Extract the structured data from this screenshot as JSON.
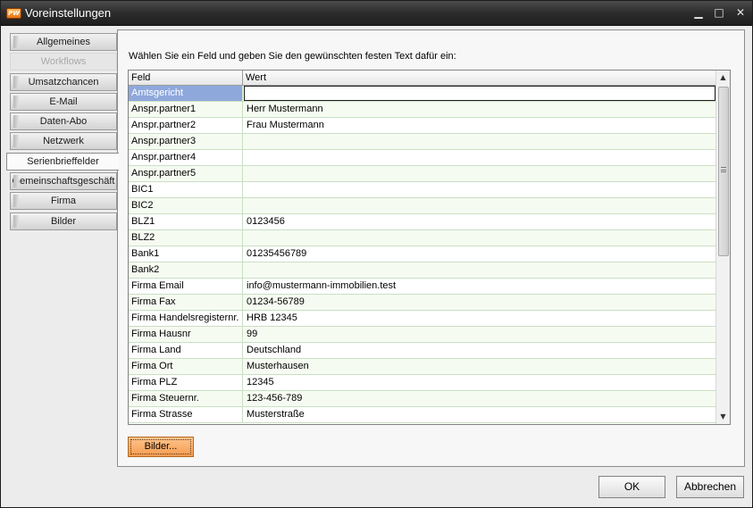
{
  "window": {
    "title": "Voreinstellungen",
    "app_icon_text": "PW",
    "minimize_glyph": "▁",
    "maximize_glyph": "□",
    "close_glyph": "✕"
  },
  "nav": {
    "items": [
      {
        "label": "Allgemeines",
        "state": "normal"
      },
      {
        "label": "Workflows",
        "state": "disabled"
      },
      {
        "label": "Umsatzchancen",
        "state": "normal"
      },
      {
        "label": "E-Mail",
        "state": "normal"
      },
      {
        "label": "Daten-Abo",
        "state": "normal"
      },
      {
        "label": "Netzwerk",
        "state": "normal"
      },
      {
        "label": "Serienbrieffelder",
        "state": "active"
      },
      {
        "label": "Gemeinschaftsgeschäft",
        "state": "normal"
      },
      {
        "label": "Firma",
        "state": "normal"
      },
      {
        "label": "Bilder",
        "state": "normal"
      }
    ]
  },
  "main": {
    "instruction": "Wählen Sie ein Feld und geben Sie den gewünschten festen Text dafür ein:",
    "grid": {
      "columns": [
        "Feld",
        "Wert"
      ],
      "rows": [
        {
          "feld": "Amtsgericht",
          "wert": "",
          "selected": true
        },
        {
          "feld": "Anspr.partner1",
          "wert": "Herr Mustermann"
        },
        {
          "feld": "Anspr.partner2",
          "wert": "Frau Mustermann"
        },
        {
          "feld": "Anspr.partner3",
          "wert": ""
        },
        {
          "feld": "Anspr.partner4",
          "wert": ""
        },
        {
          "feld": "Anspr.partner5",
          "wert": ""
        },
        {
          "feld": "BIC1",
          "wert": ""
        },
        {
          "feld": "BIC2",
          "wert": ""
        },
        {
          "feld": "BLZ1",
          "wert": "0123456"
        },
        {
          "feld": "BLZ2",
          "wert": ""
        },
        {
          "feld": "Bank1",
          "wert": "01235456789"
        },
        {
          "feld": "Bank2",
          "wert": ""
        },
        {
          "feld": "Firma Email",
          "wert": "info@mustermann-immobilien.test"
        },
        {
          "feld": "Firma Fax",
          "wert": "01234-56789"
        },
        {
          "feld": "Firma Handelsregisternr.",
          "wert": "HRB 12345"
        },
        {
          "feld": "Firma Hausnr",
          "wert": "99"
        },
        {
          "feld": "Firma Land",
          "wert": "Deutschland"
        },
        {
          "feld": "Firma Ort",
          "wert": "Musterhausen"
        },
        {
          "feld": "Firma PLZ",
          "wert": "12345"
        },
        {
          "feld": "Firma Steuernr.",
          "wert": "123-456-789"
        },
        {
          "feld": "Firma Strasse",
          "wert": "Musterstraße"
        }
      ]
    },
    "bilder_button": "Bilder..."
  },
  "footer": {
    "ok_label": "OK",
    "cancel_label": "Abbrechen"
  },
  "colors": {
    "title_bar": "#2c2c2c",
    "selected_cell": "#8fa8dc",
    "row_alt": "#f6fbf2",
    "bilder_button": "#f59b4f"
  }
}
